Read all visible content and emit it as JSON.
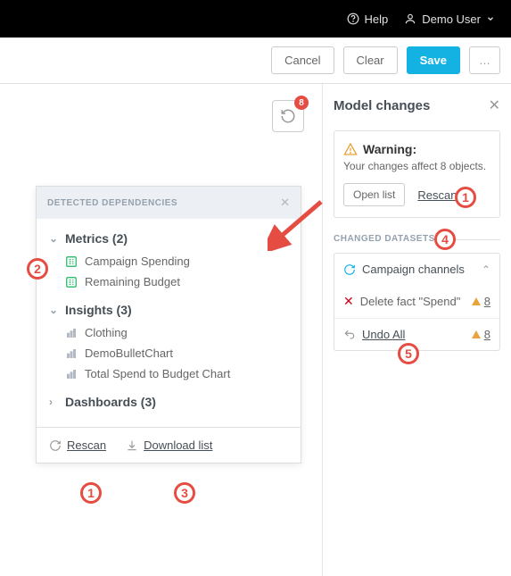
{
  "topbar": {
    "help": "Help",
    "user": "Demo User"
  },
  "actions": {
    "cancel": "Cancel",
    "clear": "Clear",
    "save": "Save",
    "more": "…"
  },
  "undo_badge": "8",
  "right": {
    "title": "Model changes",
    "warning_title": "Warning:",
    "warning_text": "Your changes affect 8 objects.",
    "open_list": "Open list",
    "rescan": "Rescan",
    "changed_datasets": "CHANGED DATASETS",
    "dataset_name": "Campaign channels",
    "delete_fact": "Delete fact \"Spend\"",
    "delete_count": "8",
    "undo_all": "Undo All",
    "undo_count": "8"
  },
  "left": {
    "title": "DETECTED DEPENDENCIES",
    "metrics_h": "Metrics (2)",
    "m1": "Campaign Spending",
    "m2": "Remaining Budget",
    "insights_h": "Insights (3)",
    "i1": "Clothing",
    "i2": "DemoBulletChart",
    "i3": "Total Spend to Budget Chart",
    "dash_h": "Dashboards (3)",
    "rescan": "Rescan",
    "download": "Download list"
  },
  "callouts": {
    "c1": "1",
    "c2": "2",
    "c3": "3",
    "c4": "4",
    "c5": "5",
    "c1b": "1"
  }
}
